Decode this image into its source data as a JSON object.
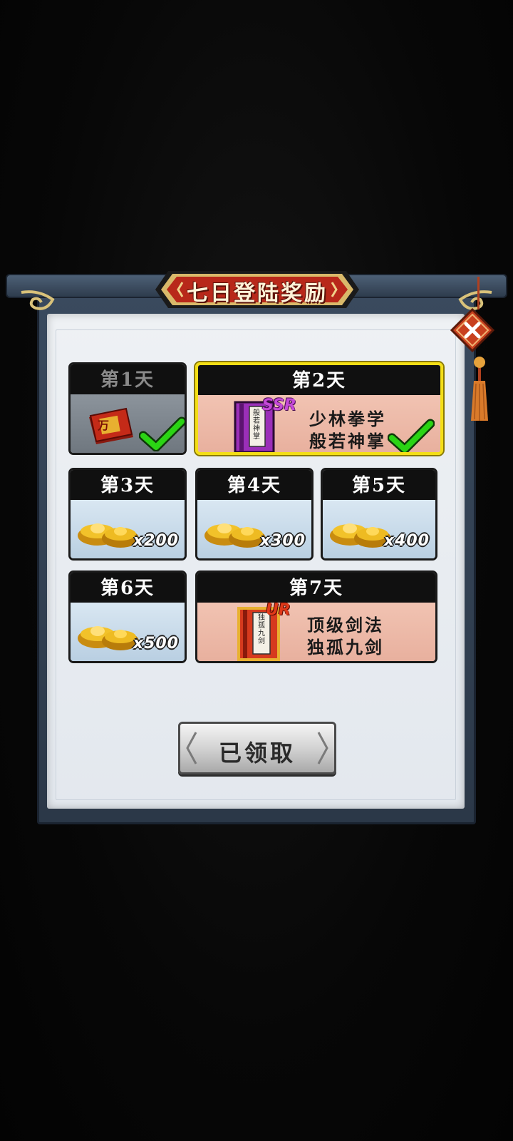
{
  "title": "七日登陆奖励",
  "close_button": {
    "icon": "close-icon"
  },
  "days": [
    {
      "label": "第1天",
      "reward": "万",
      "claimed": true
    },
    {
      "label": "第2天",
      "rarity": "SSR",
      "book_cover": "般若神掌",
      "name_line1": "少林拳学",
      "name_line2": "般若神掌",
      "claimed": true
    },
    {
      "label": "第3天",
      "qty": "x200"
    },
    {
      "label": "第4天",
      "qty": "x300"
    },
    {
      "label": "第5天",
      "qty": "x400"
    },
    {
      "label": "第6天",
      "qty": "x500"
    },
    {
      "label": "第7天",
      "rarity": "UR",
      "book_cover": "独孤九剑",
      "name_line1": "顶级剑法",
      "name_line2": "独孤九剑"
    }
  ],
  "claim_button": {
    "label": "已领取"
  },
  "colors": {
    "frame": "#2b3848",
    "selected_border": "#f4de16",
    "check": "#2bd414",
    "title_bg": "#b8281a"
  }
}
